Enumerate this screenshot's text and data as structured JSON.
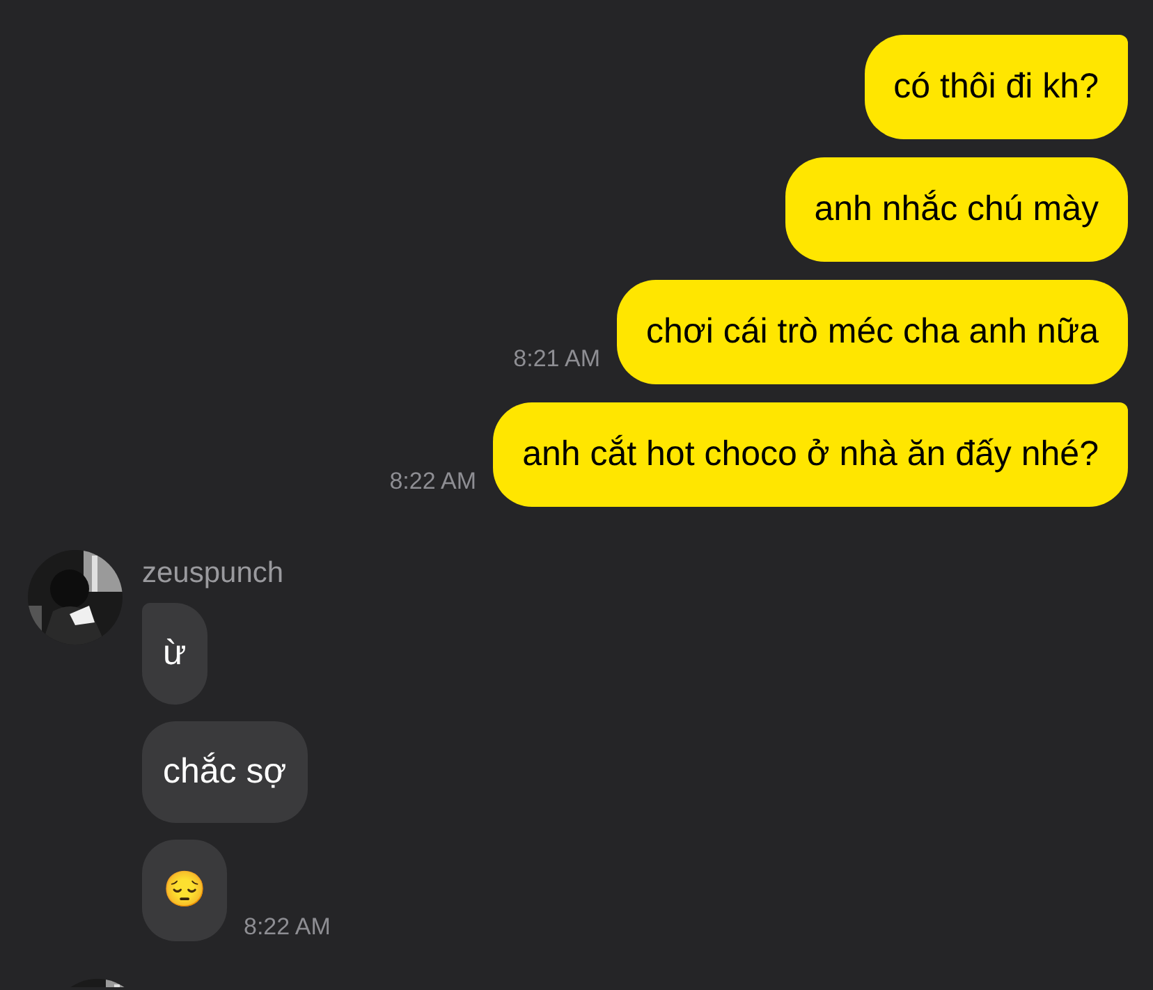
{
  "outgoing": [
    {
      "text": "có thôi đi kh?",
      "tail": true
    },
    {
      "text": "anh nhắc chú mày",
      "tail": false
    },
    {
      "text": "chơi cái trò méc cha anh nữa",
      "time": "8:21 AM",
      "tail": false
    },
    {
      "text": "anh cắt hot choco ở nhà ăn đấy nhé?",
      "time": "8:22 AM",
      "tail": true
    }
  ],
  "incoming": {
    "sender": "zeuspunch",
    "messages": [
      {
        "text": "ừ",
        "tail": true
      },
      {
        "text": "chắc sợ",
        "tail": false
      },
      {
        "text": "😔",
        "time": "8:22 AM",
        "tail": false
      }
    ]
  }
}
